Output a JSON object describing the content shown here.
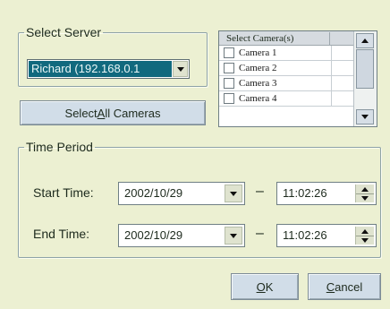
{
  "window": {
    "background": "#ecf0d2"
  },
  "server": {
    "legend": "Select Server",
    "selected": "Richard (192.168.0.1",
    "highlight_color": "#11697e"
  },
  "buttons": {
    "select_all_pre": "Select ",
    "select_all_accel": "A",
    "select_all_post": "ll Cameras",
    "ok_accel": "O",
    "ok_post": "K",
    "cancel_accel": "C",
    "cancel_post": "ancel"
  },
  "cameras": {
    "header": "Select Camera(s)",
    "items": [
      {
        "label": "Camera 1",
        "checked": false
      },
      {
        "label": "Camera 2",
        "checked": false
      },
      {
        "label": "Camera 3",
        "checked": false
      },
      {
        "label": "Camera 4",
        "checked": false
      }
    ]
  },
  "time_period": {
    "legend": "Time Period",
    "separator": "–",
    "start": {
      "label": "Start Time:",
      "date": "2002/10/29",
      "time": "11:02:26"
    },
    "end": {
      "label": "End Time:",
      "date": "2002/10/29",
      "time": "11:02:26"
    }
  },
  "icons": {
    "dropdown": "chevron-down-icon",
    "scroll_up": "arrow-up-icon",
    "scroll_down": "arrow-down-icon",
    "spin": "spin-arrows-icon"
  }
}
